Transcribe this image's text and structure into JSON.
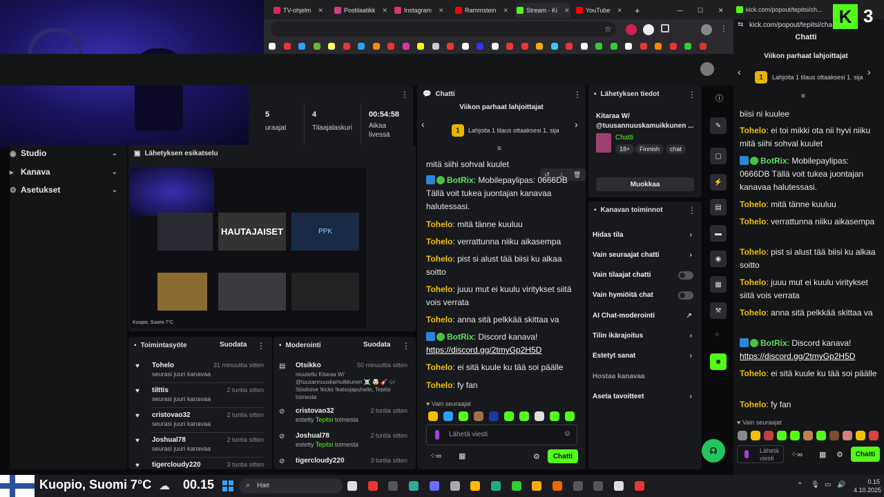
{
  "browser": {
    "tabs": [
      {
        "label": "TV-ohjelm",
        "color": "#e0245e"
      },
      {
        "label": "Postilaatikk",
        "color": "#d33a8a"
      },
      {
        "label": "Instagram",
        "color": "#e1306c"
      },
      {
        "label": "Rammstein",
        "color": "#ff0000"
      },
      {
        "label": "Stream - Ki",
        "color": "#53fc18"
      },
      {
        "label": "YouTube",
        "color": "#ff0000"
      }
    ],
    "new_tab": "+",
    "window_min": "—",
    "window_max": "☐",
    "window_close": "✕"
  },
  "sidebar": {
    "items": [
      {
        "label": "Studio",
        "icon": "studio-icon"
      },
      {
        "label": "Kanava",
        "icon": "channel-icon"
      },
      {
        "label": "Asetukset",
        "icon": "settings-icon"
      }
    ]
  },
  "stats": [
    {
      "value": "5",
      "label": "uraajat"
    },
    {
      "value": "4",
      "label": "Tilaajalaskuri"
    },
    {
      "value": "00:54:58",
      "label": "Aikaa\nlivessä"
    }
  ],
  "preview": {
    "title": "Lähetyksen esikatselu",
    "thumbs": [
      {
        "title": "HAUTAJAISET"
      },
      {
        "title": "PPK"
      }
    ],
    "status": "Kuopio, Suomi 7°C"
  },
  "activity": {
    "title": "Toimintasyöte",
    "filter": "Suodata",
    "items": [
      {
        "name": "Tohelo",
        "sub": "seurasi juuri kanavaa",
        "time": "31 minuuttia sitten"
      },
      {
        "name": "tilttis",
        "sub": "seurasi juuri kanavaa",
        "time": "2 tuntia sitten"
      },
      {
        "name": "cristovao32",
        "sub": "seurasi juuri kanavaa",
        "time": "2 tuntia sitten"
      },
      {
        "name": "Joshual78",
        "sub": "seurasi juuri kanavaa",
        "time": "2 tuntia sitten"
      },
      {
        "name": "tigercloudy220",
        "sub": "",
        "time": "3 tuntia sitten"
      }
    ]
  },
  "moderation": {
    "title": "Moderointi",
    "filter": "Suodata",
    "items": [
      {
        "name": "Otsikko",
        "sub": "muutettu Kitaraa W/ @tuusannuuskamuikkunen ☠️ 🤯 🎸 🎶 !biisitoive !kicks !katsojapuhelin, Tepitsi toimesta",
        "time": "50 minuuttia sitten"
      },
      {
        "name": "cristovao32",
        "sub_pre": "estetty ",
        "sub_hl": "Tepitsi",
        "sub_post": " toimesta",
        "time": "2 tuntia sitten"
      },
      {
        "name": "Joshual78",
        "sub_pre": "estetty ",
        "sub_hl": "Tepitsi",
        "sub_post": " toimesta",
        "time": "2 tuntia sitten"
      },
      {
        "name": "tigercloudy220",
        "time": "3 tuntia sitten"
      }
    ]
  },
  "chat": {
    "title": "Chatti",
    "gifters_title": "Viikon parhaat lahjoittajat",
    "gifters_sub": "Lahjoita 1 tilaus ottaaksesi 1. sija",
    "rank": "1",
    "partial_top": "mitä siihi sohval kuulet",
    "messages": [
      {
        "user": "BotRix",
        "bot": true,
        "text": "Mobilepaylipas: 0666DB Tällä voit tukea juontajan kanavaa halutessasi."
      },
      {
        "user": "Tohelo",
        "text": "mitä tänne kuuluu"
      },
      {
        "user": "Tohelo",
        "text": "verrattunna niiku aikasempa"
      },
      {
        "user": "Tohelo",
        "text": "pist si alust tää biisi ku alkaa soitto"
      },
      {
        "user": "Tohelo",
        "text": "juuu mut ei kuulu viritykset siitä vois verrata"
      },
      {
        "user": "Tohelo",
        "text": "anna sitä pelkkää skittaa va"
      },
      {
        "user": "BotRix",
        "bot": true,
        "text": "Discord kanava!",
        "link": "https://discord.gg/2tmyGp2H5D"
      },
      {
        "user": "Tohelo",
        "text": "ei sitä kuule ku tää soi päälle"
      },
      {
        "user": "Tohelo",
        "text": "fy fan"
      }
    ],
    "followers_only": "Vain seuraajat",
    "input_placeholder": "Lähetä viesti",
    "send_label": "Chatti"
  },
  "stream_info": {
    "title": "Lähetyksen tiedot",
    "stream_title": "Kitaraa W/ @tuusannuuskamuikkunen ...",
    "category": "Chatti",
    "tags": [
      "18+",
      "Finnish",
      "chat"
    ],
    "edit_label": "Muokkaa"
  },
  "channel_actions": {
    "title": "Kanavan toiminnot",
    "items": [
      {
        "label": "Hidas tila",
        "type": "chevron"
      },
      {
        "label": "Vain seuraajat chatti",
        "type": "chevron"
      },
      {
        "label": "Vain tilaajat chatti",
        "type": "toggle"
      },
      {
        "label": "Vain hymiöitä chat",
        "type": "toggle"
      },
      {
        "label": "AI Chat-moderointi",
        "type": "external"
      },
      {
        "label": "Tilin ikärajoitus",
        "type": "chevron"
      },
      {
        "label": "Estetyt sanat",
        "type": "chevron"
      },
      {
        "label": "Hostaa kanavaa",
        "type": "none"
      },
      {
        "label": "Aseta tavoitteet",
        "type": "chevron"
      }
    ]
  },
  "popout": {
    "url": "kick.com/popout/tepitsi/chat",
    "tab_title": "kick.com/popout/tepitsi/ch...",
    "title": "Chatti",
    "gifters_title": "Viikon parhaat lahjoittajat",
    "gifters_sub": "Lahjoita 1 tilaus ottaaksesi 1. sija",
    "rank": "1",
    "partial_top": "biisi ni kuulee",
    "messages": [
      {
        "user": "Tohelo",
        "text": "ei toi mikki ota nii hyvi niiku mitä siihi sohval kuulet"
      },
      {
        "user": "BotRix",
        "bot": true,
        "text": "Mobilepaylipas: 0666DB Tällä voit tukea juontajan kanavaa halutessasi."
      },
      {
        "user": "Tohelo",
        "text": "mitä tänne kuuluu"
      },
      {
        "user": "Tohelo",
        "text": "verrattunna niiku aikasempa"
      },
      {
        "user": "Tohelo",
        "text": "pist si alust tää biisi ku alkaa soitto"
      },
      {
        "user": "Tohelo",
        "text": "juuu mut ei kuulu viritykset siitä vois verrata"
      },
      {
        "user": "Tohelo",
        "text": "anna sitä pelkkää skittaa va"
      },
      {
        "user": "BotRix",
        "bot": true,
        "text": "Discord kanava!",
        "link": "https://discord.gg/2tmyGp2H5D"
      },
      {
        "user": "Tohelo",
        "text": "ei sitä kuule ku tää soi päälle"
      },
      {
        "user": "Tohelo",
        "text": "fy fan"
      }
    ],
    "followers_only": "Vain seuraajat",
    "input_placeholder": "Lähetä viesti",
    "send_label": "Chatti"
  },
  "taskbar": {
    "weather": "Kuopio, Suomi 7°C",
    "clock": "00.15",
    "search": "Hae",
    "tray_time": "0.15",
    "tray_date": "4.10.2025"
  },
  "colors": {
    "kick_green": "#53fc18",
    "username": "#f0c000",
    "bot": "#5fe05f"
  }
}
